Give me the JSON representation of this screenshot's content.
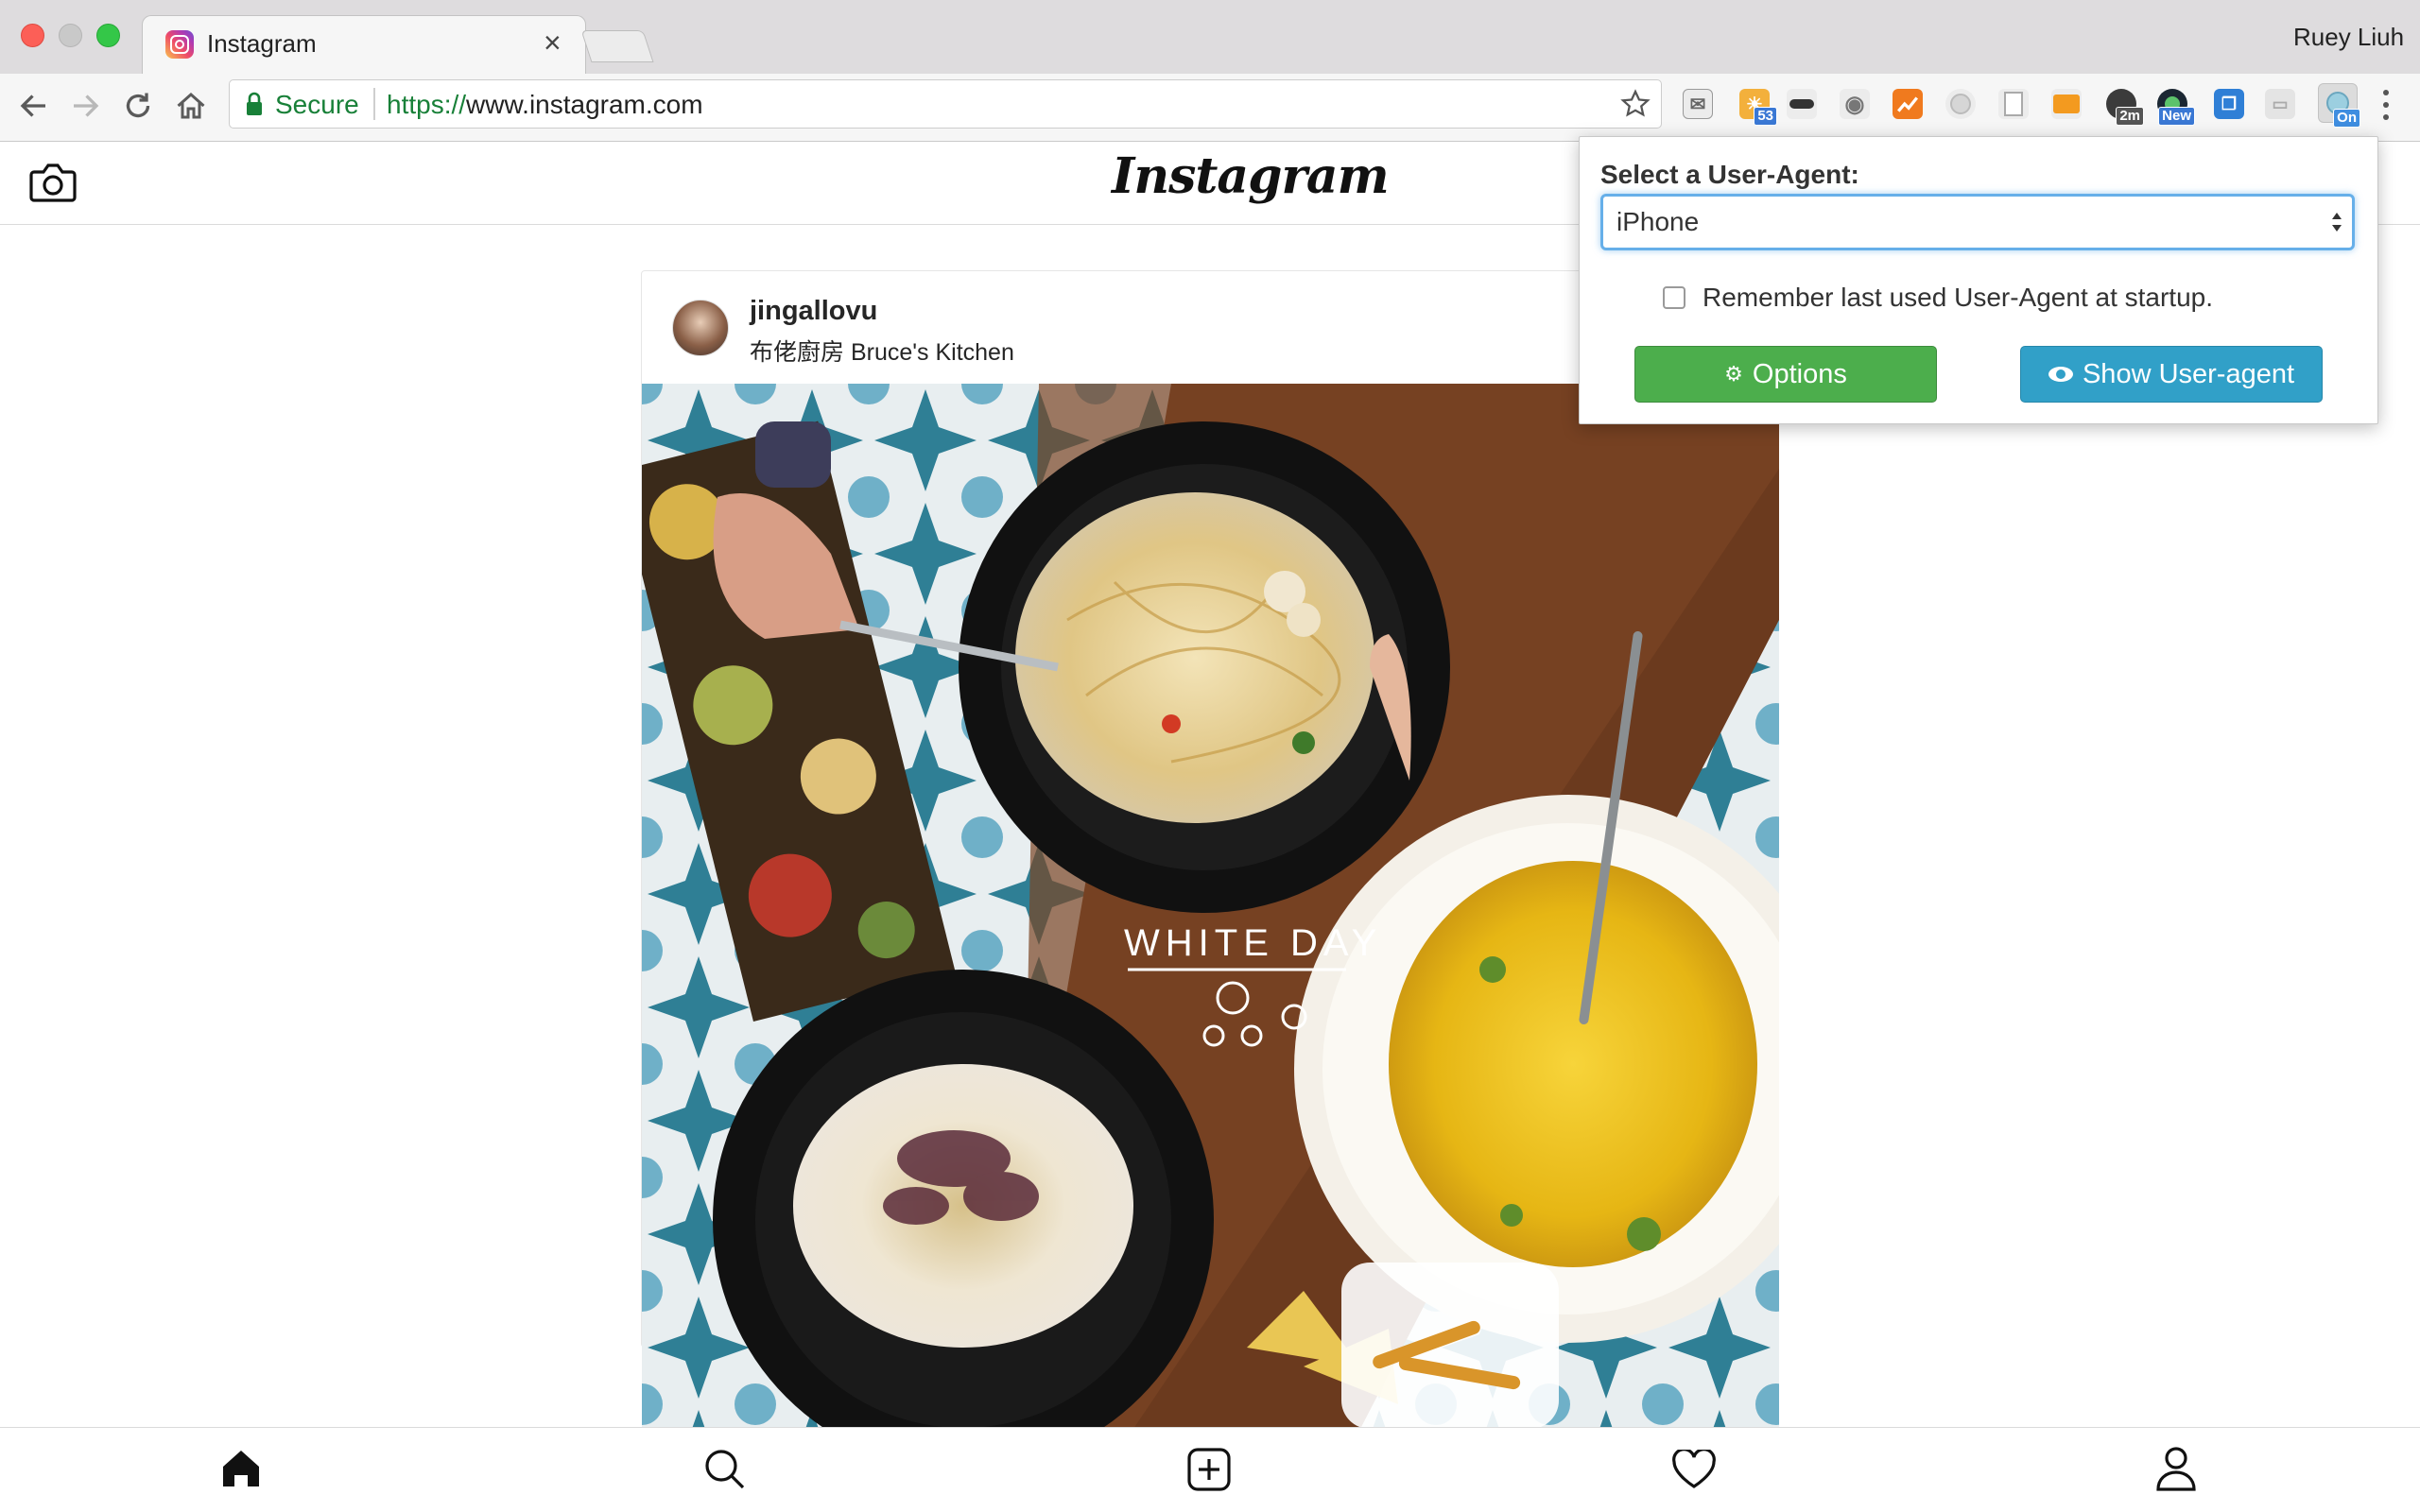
{
  "browser": {
    "tab_title": "Instagram",
    "tab_close": "×",
    "profile_name": "Ruey Liuh",
    "secure_label": "Secure",
    "url_scheme": "https://",
    "url_host": "www.instagram.com"
  },
  "extensions": [
    {
      "name": "mail-extension-icon",
      "badge": ""
    },
    {
      "name": "weather-extension-icon",
      "badge": "53"
    },
    {
      "name": "incognito-extension-icon",
      "badge": ""
    },
    {
      "name": "camera-extension-icon",
      "badge": ""
    },
    {
      "name": "chart-extension-icon",
      "badge": ""
    },
    {
      "name": "disc-extension-icon",
      "badge": ""
    },
    {
      "name": "document-extension-icon",
      "badge": ""
    },
    {
      "name": "envelope-extension-icon",
      "badge": ""
    },
    {
      "name": "timer-extension-icon",
      "badge": "2m"
    },
    {
      "name": "audio-extension-icon",
      "badge": "New"
    },
    {
      "name": "reader-extension-icon",
      "badge": ""
    },
    {
      "name": "cast-extension-icon",
      "badge": ""
    },
    {
      "name": "user-agent-switcher-icon",
      "badge": "On"
    }
  ],
  "instagram": {
    "logo": "Instagram",
    "post": {
      "username": "jingallovu",
      "location": "布佬廚房 Bruce's Kitchen",
      "photo_caption": "WHITE DAY"
    }
  },
  "popup": {
    "heading": "Select a User-Agent:",
    "selected_agent": "iPhone",
    "remember_label": "Remember last used User-Agent at startup.",
    "remember_checked": false,
    "options_label": "Options",
    "show_label": "Show User-agent"
  },
  "colors": {
    "secure_green": "#188038",
    "options_green": "#4cae4c",
    "show_blue": "#31a0c8",
    "focus_blue": "#66afe9",
    "ext_badge_blue": "#3a78d4"
  }
}
